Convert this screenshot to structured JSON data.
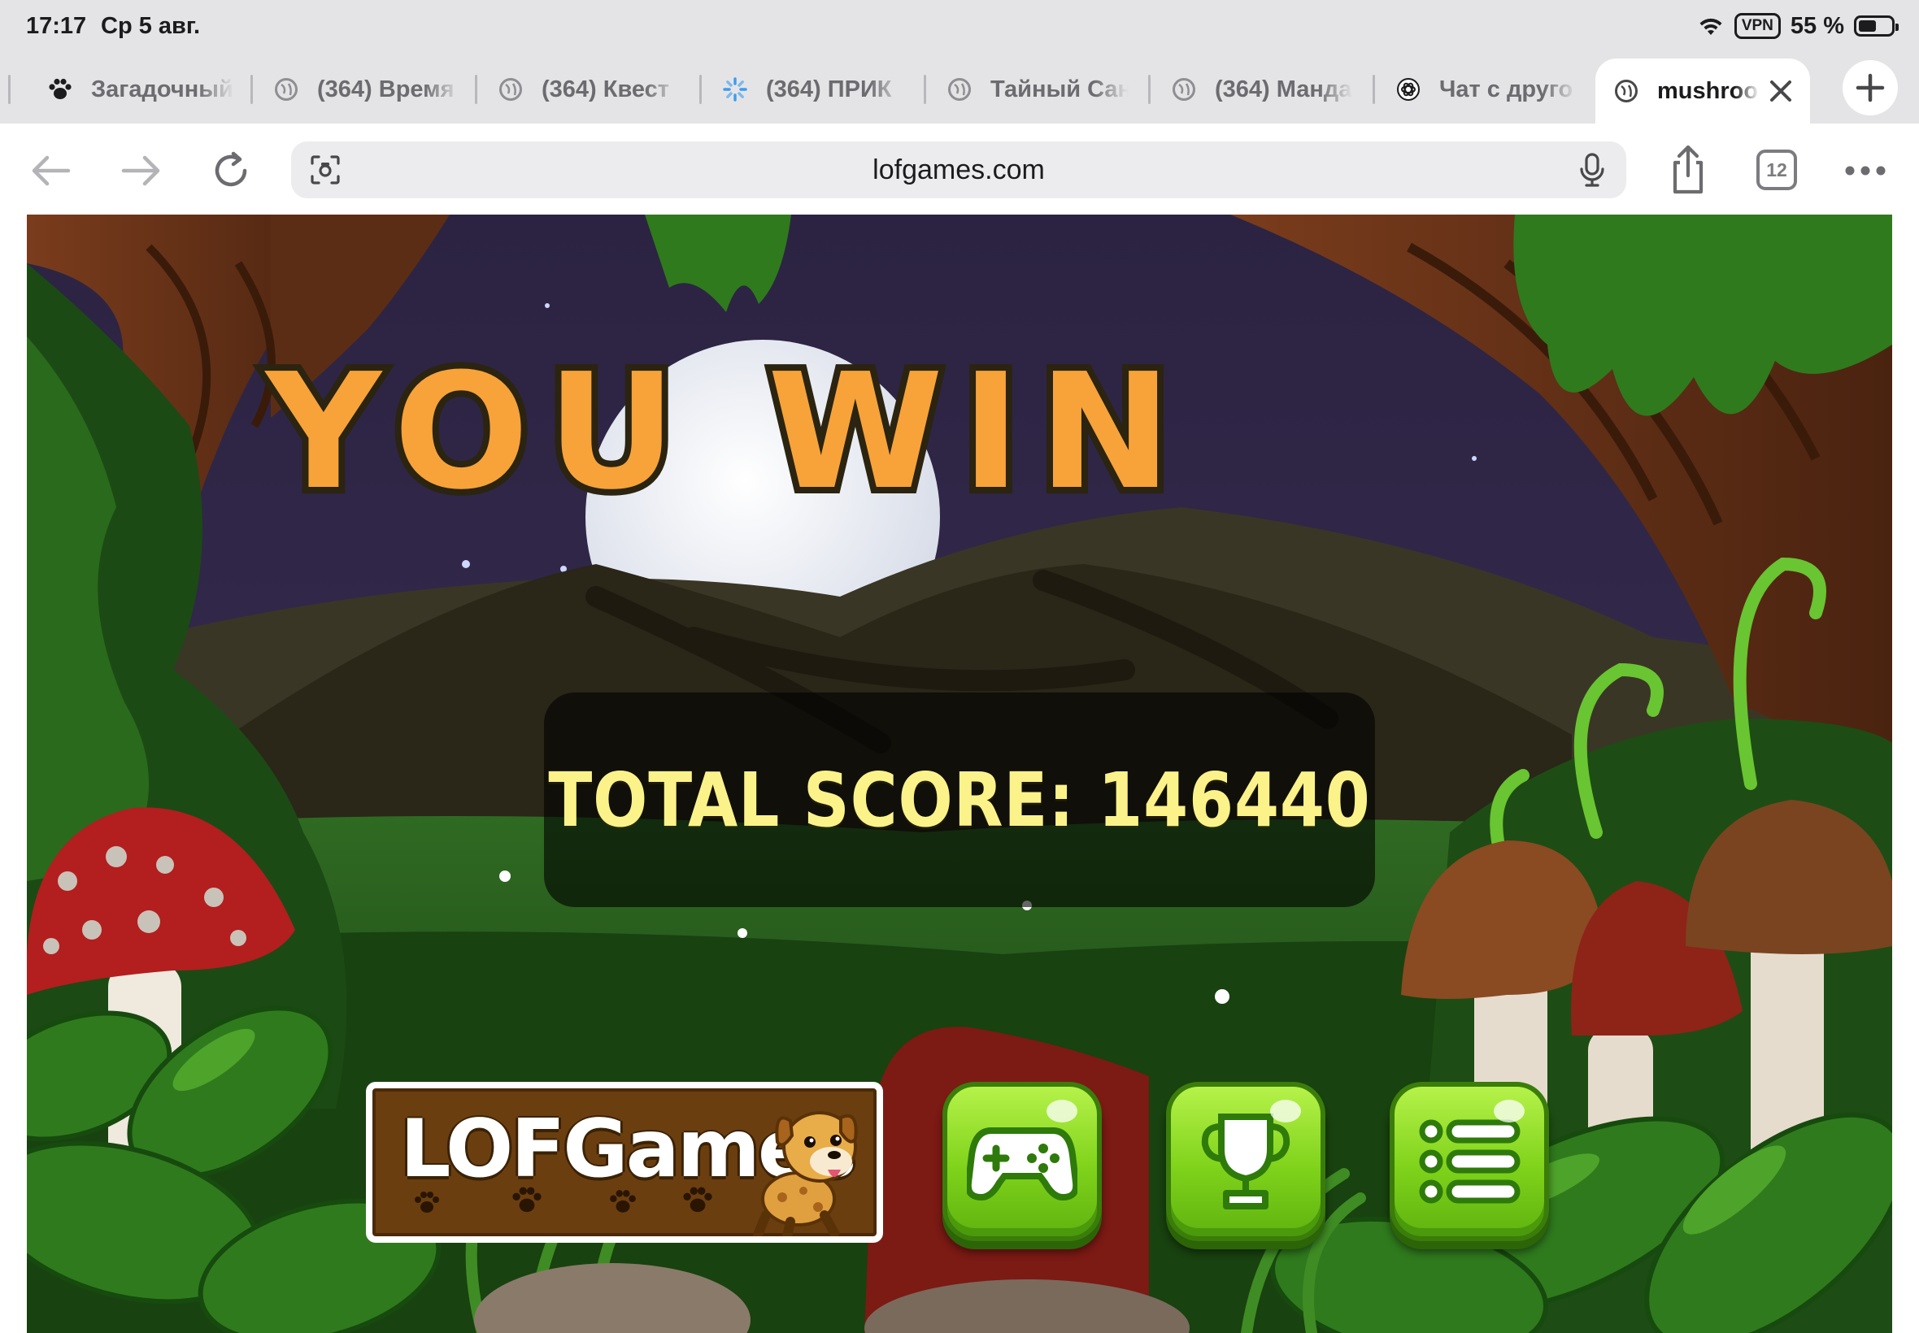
{
  "status_bar": {
    "time": "17:17",
    "date": "Ср 5 авг.",
    "vpn_label": "VPN",
    "battery_percent": "55 %",
    "battery_level": 0.55
  },
  "tabs": [
    {
      "title": "Загадочный",
      "favicon": "paw-icon",
      "active": false
    },
    {
      "title": "(364) Время",
      "favicon": "globe-icon",
      "active": false
    },
    {
      "title": "(364) Квест",
      "favicon": "globe-icon",
      "active": false
    },
    {
      "title": "(364) ПРИК",
      "favicon": "loading-spinner-icon",
      "active": false
    },
    {
      "title": "Тайный Сан",
      "favicon": "globe-icon",
      "active": false
    },
    {
      "title": "(364) Манда",
      "favicon": "globe-icon",
      "active": false
    },
    {
      "title": "Чат с друго",
      "favicon": "openai-icon",
      "active": false
    },
    {
      "title": "mushroo",
      "favicon": "globe-icon",
      "active": true
    }
  ],
  "toolbar": {
    "url": "lofgames.com",
    "tab_count": "12",
    "icons": [
      "back-arrow-icon",
      "forward-arrow-icon",
      "reload-icon",
      "lens-icon",
      "microphone-icon",
      "share-icon",
      "more-icon"
    ]
  },
  "game": {
    "title": "YOU WIN",
    "score_text": "TOTAL SCORE: 146440",
    "logo_text": "LOFGames",
    "buttons": [
      {
        "name": "play-button",
        "icon": "gamepad-icon"
      },
      {
        "name": "leaderboard-button",
        "icon": "trophy-icon"
      },
      {
        "name": "menu-button",
        "icon": "list-icon"
      }
    ],
    "colors": {
      "title_orange": "#f7a33a",
      "score_yellow": "#fbf38a",
      "button_green": "#8fdc21"
    }
  }
}
